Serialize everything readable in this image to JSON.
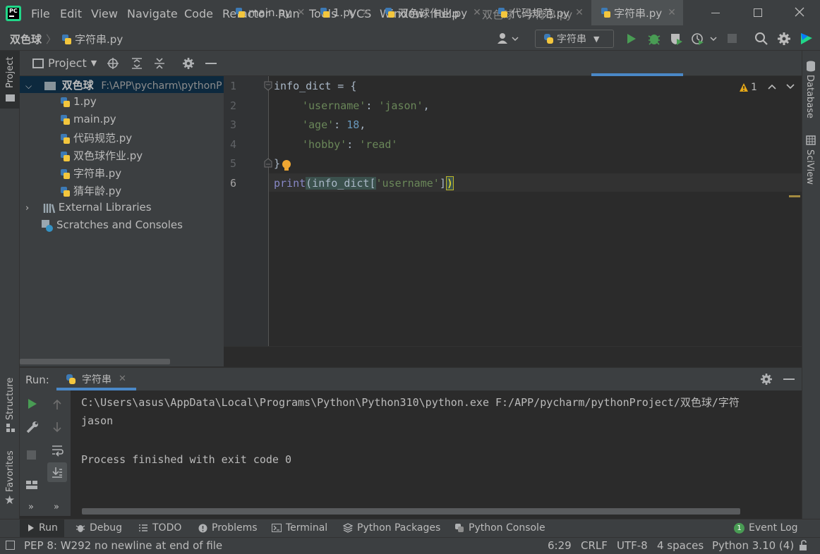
{
  "menu": [
    "File",
    "Edit",
    "View",
    "Navigate",
    "Code",
    "Refactor",
    "Run",
    "Tools",
    "VCS",
    "Window",
    "Help"
  ],
  "window_title": "双色球 - 字符串.py",
  "breadcrumb": {
    "project": "双色球",
    "file": "字符串.py"
  },
  "run_config": "字符串",
  "left_strip": {
    "project": "Project",
    "structure": "Structure",
    "favorites": "Favorites"
  },
  "right_strip": {
    "database": "Database",
    "sciview": "SciView"
  },
  "project_panel": {
    "title": "Project",
    "root": {
      "name": "双色球",
      "path": "F:\\APP\\pycharm\\pythonP"
    },
    "files": [
      "1.py",
      "main.py",
      "代码规范.py",
      "双色球作业.py",
      "字符串.py",
      "猜年龄.py"
    ],
    "external": "External Libraries",
    "scratches": "Scratches and Consoles"
  },
  "tabs": [
    {
      "label": "main.py",
      "active": false
    },
    {
      "label": "1.py",
      "active": false
    },
    {
      "label": "双色球作业.py",
      "active": false
    },
    {
      "label": "代码规范.py",
      "active": false
    },
    {
      "label": "字符串.py",
      "active": true
    }
  ],
  "editor": {
    "line_numbers": [
      "1",
      "2",
      "3",
      "4",
      "5",
      "6"
    ],
    "warning_count": "1",
    "lines": {
      "l1_var": "info_dict",
      "l1_rest": " = {",
      "l2_key": "'username'",
      "l2_sep": ": ",
      "l2_val": "'jason'",
      "l2_end": ",",
      "l3_key": "'age'",
      "l3_sep": ": ",
      "l3_val": "18",
      "l3_end": ",",
      "l4_key": "'hobby'",
      "l4_sep": ": ",
      "l4_val": "'read'",
      "l5": "}",
      "l6_fn": "print",
      "l6_a": "(info_dict[",
      "l6_str": "'username'",
      "l6_b": "]",
      "l6_c": ")"
    }
  },
  "run_panel": {
    "label": "Run:",
    "tab": "字符串",
    "output": [
      "C:\\Users\\asus\\AppData\\Local\\Programs\\Python\\Python310\\python.exe F:/APP/pycharm/pythonProject/双色球/字符",
      "jason",
      "",
      "Process finished with exit code 0"
    ]
  },
  "bottom_tabs": [
    "Run",
    "Debug",
    "TODO",
    "Problems",
    "Terminal",
    "Python Packages",
    "Python Console"
  ],
  "event_log": {
    "count": "1",
    "label": "Event Log"
  },
  "status": {
    "message": "PEP 8: W292 no newline at end of file",
    "position": "6:29",
    "line_sep": "CRLF",
    "encoding": "UTF-8",
    "indent": "4 spaces",
    "interpreter": "Python 3.10 (4)"
  },
  "colors": {
    "bg": "#2b2b2b",
    "panel": "#3c3f41",
    "string": "#6a8759",
    "number": "#6897bb",
    "builtin": "#8888c6",
    "run_green": "#499c54",
    "selection": "#0d293e"
  }
}
